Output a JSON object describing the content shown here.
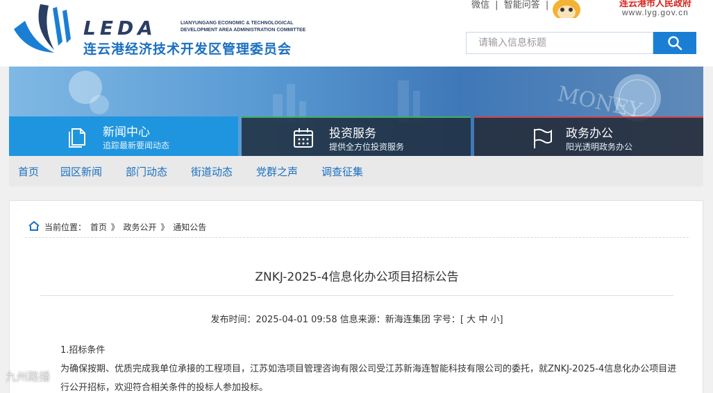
{
  "header": {
    "logo_mark": "LEDA",
    "logo_en": "LIANYUNGANG ECONOMIC & TECHNOLOGICAL DEVELOPMENT AREA ADMINISTRATION COMMITTEE",
    "logo_cn": "连云港经济技术开发区管理委员会",
    "top_links": [
      "微信",
      "|",
      "智能问答",
      "|"
    ],
    "gov_name": "连云港市人民政府",
    "gov_url": "www.lyg.gov.cn",
    "search_placeholder": "请输入信息标题"
  },
  "banner_tabs": [
    {
      "title": "新闻中心",
      "subtitle": "追踪最新要闻动态",
      "icon": "document-icon"
    },
    {
      "title": "投资服务",
      "subtitle": "提供全方位投资服务",
      "icon": "calendar-icon"
    },
    {
      "title": "政务办公",
      "subtitle": "阳光透明政务办公",
      "icon": "flag-icon"
    }
  ],
  "banner_decor": "MONEY",
  "nav": [
    "首页",
    "园区新闻",
    "部门动态",
    "街道动态",
    "党群之声",
    "调查征集"
  ],
  "breadcrumb": [
    "当前位置：",
    "首页",
    "》",
    "政务公开",
    "》",
    "通知公告"
  ],
  "article": {
    "title": "ZNKJ-2025-4信息化办公项目招标公告",
    "publish_label": "发布时间：",
    "publish_time": "2025-04-01 09:58",
    "source_label": "信息来源：",
    "source": "新海连集团",
    "font_label": "字号：",
    "font_open": "[",
    "font_sizes": [
      "大",
      "中",
      "小"
    ],
    "font_close": "]",
    "section_1": "1.招标条件",
    "para_1": "为确保按期、优质完成我单位承接的工程项目，江苏如浩项目管理咨询有限公司受江苏新海连智能科技有限公司的委托，就ZNKJ-2025-4信息化办公项目进行公开招标，欢迎符合相关条件的投标人参加投标。"
  },
  "watermark": "九州路播",
  "colors": {
    "brand_blue": "#1a7fd4",
    "nav_blue": "#1a6fc0",
    "gov_red": "#d6241d",
    "news_tab": "#1f95df",
    "invest_accent": "#3fb05a",
    "gov_accent": "#d64048"
  }
}
